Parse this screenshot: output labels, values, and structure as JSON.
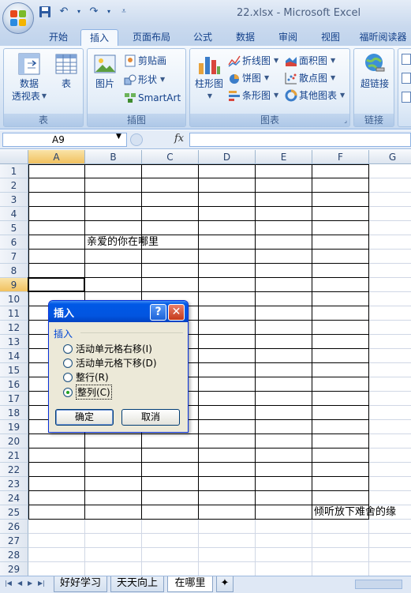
{
  "window": {
    "title": "22.xlsx - Microsoft Excel"
  },
  "tabs": [
    {
      "label": "开始",
      "active": false
    },
    {
      "label": "插入",
      "active": true
    },
    {
      "label": "页面布局",
      "active": false
    },
    {
      "label": "公式",
      "active": false
    },
    {
      "label": "数据",
      "active": false
    },
    {
      "label": "审阅",
      "active": false
    },
    {
      "label": "视图",
      "active": false
    },
    {
      "label": "福昕阅读器",
      "active": false
    }
  ],
  "ribbon": {
    "groups": {
      "table": {
        "label": "表",
        "pivot_label_1": "数据",
        "pivot_label_2": "透视表",
        "table_label": "表"
      },
      "illustrations": {
        "label": "插图",
        "picture_label": "图片",
        "clipart_label": "剪贴画",
        "shapes_label": "形状",
        "smartart_label": "SmartArt"
      },
      "charts": {
        "label": "图表",
        "column_label": "柱形图",
        "line_label": "折线图",
        "pie_label": "饼图",
        "bar_label": "条形图",
        "area_label": "面积图",
        "scatter_label": "散点图",
        "other_label": "其他图表"
      },
      "links": {
        "label": "链接",
        "hyperlink_label": "超链接"
      }
    }
  },
  "formula_bar": {
    "name_box": "A9",
    "fx": "fx",
    "formula": ""
  },
  "sheet": {
    "columns": [
      "A",
      "B",
      "C",
      "D",
      "E",
      "F",
      "G"
    ],
    "selected_column": "A",
    "rows": [
      "1",
      "2",
      "3",
      "4",
      "5",
      "6",
      "7",
      "8",
      "9",
      "10",
      "11",
      "12",
      "13",
      "14",
      "15",
      "16",
      "17",
      "18",
      "19",
      "20",
      "21",
      "22",
      "23",
      "24",
      "25",
      "26",
      "27",
      "28",
      "29"
    ],
    "selected_row": "9",
    "cells": {
      "B6": "亲爱的你在哪里",
      "F25": "倾听放下难舍的缘"
    }
  },
  "sheet_tabs": [
    {
      "label": "好好学习",
      "active": false
    },
    {
      "label": "天天向上",
      "active": false
    },
    {
      "label": "在哪里",
      "active": true
    }
  ],
  "dialog": {
    "title": "插入",
    "help_glyph": "?",
    "close_glyph": "✕",
    "group_label": "插入",
    "options": [
      {
        "label": "活动单元格右移(I)",
        "checked": false
      },
      {
        "label": "活动单元格下移(D)",
        "checked": false
      },
      {
        "label": "整行(R)",
        "checked": false
      },
      {
        "label": "整列(C)",
        "checked": true
      }
    ],
    "ok_label": "确定",
    "cancel_label": "取消"
  },
  "colors": {
    "ribbon_text": "#15428b",
    "dialog_title": "#0058e6",
    "selection": "#f1c15f"
  }
}
